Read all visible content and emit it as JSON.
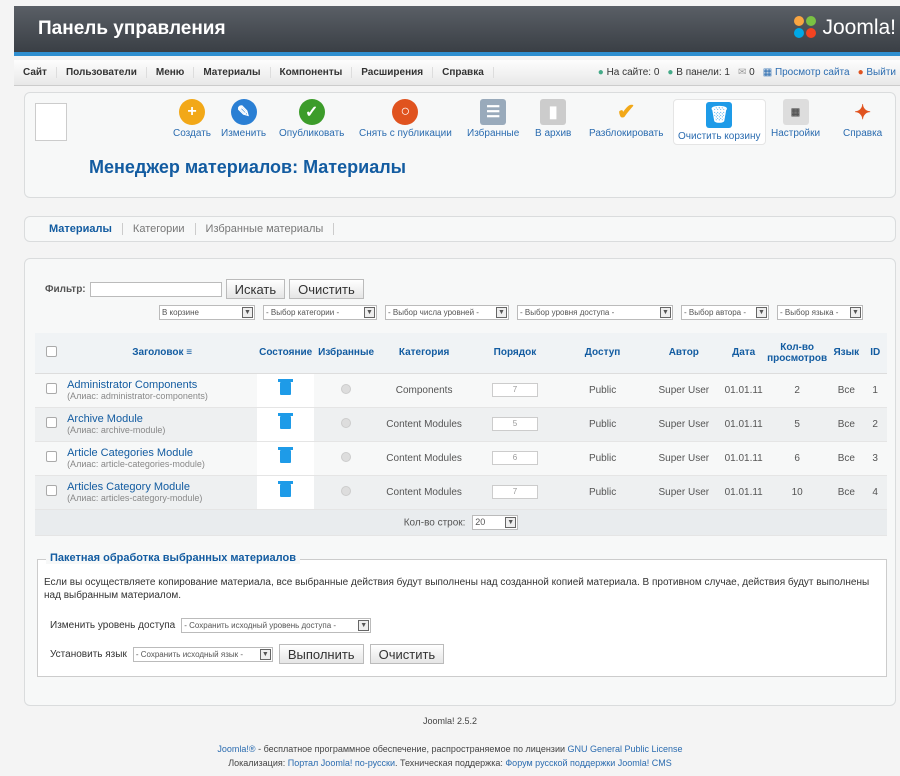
{
  "header": {
    "title": "Панель управления",
    "logo_text": "Joomla!"
  },
  "menu": {
    "items": [
      "Сайт",
      "Пользователи",
      "Меню",
      "Материалы",
      "Компоненты",
      "Расширения",
      "Справка"
    ],
    "status": {
      "on_site": "На сайте: 0",
      "in_panel": "В панели: 1",
      "messages": "0",
      "view_site": "Просмотр сайта",
      "logout": "Выйти"
    }
  },
  "toolbar": {
    "items": [
      {
        "label": "Создать",
        "icon": "plus-icon",
        "color": "#f2a818"
      },
      {
        "label": "Изменить",
        "icon": "edit-icon",
        "color": "#2a7fd4"
      },
      {
        "label": "Опубликовать",
        "icon": "check-icon",
        "color": "#3c9c2a"
      },
      {
        "label": "Снять с публикации",
        "icon": "unpublish-icon",
        "color": "#e0531f"
      },
      {
        "label": "Избранные",
        "icon": "featured-icon",
        "color": "#9ab"
      },
      {
        "label": "В архив",
        "icon": "archive-icon",
        "color": "#aaa"
      },
      {
        "label": "Разблокировать",
        "icon": "checkin-icon",
        "color": "#f2a818"
      },
      {
        "label": "Очистить корзину",
        "icon": "trash-icon",
        "color": "#1e9be8"
      },
      {
        "label": "Настройки",
        "icon": "options-icon",
        "color": "#999"
      },
      {
        "label": "Справка",
        "icon": "help-icon",
        "color": "#e0531f"
      }
    ],
    "page_title": "Менеджер материалов: Материалы"
  },
  "tabs": [
    "Материалы",
    "Категории",
    "Избранные материалы"
  ],
  "filter": {
    "label": "Фильтр:",
    "search_btn": "Искать",
    "clear_btn": "Очистить",
    "selects": [
      "В корзине",
      "- Выбор категории -",
      "- Выбор числа уровней -",
      "- Выбор уровня доступа -",
      "- Выбор автора -",
      "- Выбор языка -"
    ]
  },
  "table": {
    "headers": [
      "Заголовок",
      "Состояние",
      "Избранные",
      "Категория",
      "Порядок",
      "Доступ",
      "Автор",
      "Дата",
      "Кол-во просмотров",
      "Язык",
      "ID"
    ],
    "rows": [
      {
        "title": "Administrator Components",
        "alias": "(Алиас: administrator-components)",
        "category": "Components",
        "order": "7",
        "access": "Public",
        "author": "Super User",
        "date": "01.01.11",
        "hits": "2",
        "lang": "Все",
        "id": "1"
      },
      {
        "title": "Archive Module",
        "alias": "(Алиас: archive-module)",
        "category": "Content Modules",
        "order": "5",
        "access": "Public",
        "author": "Super User",
        "date": "01.01.11",
        "hits": "5",
        "lang": "Все",
        "id": "2"
      },
      {
        "title": "Article Categories Module",
        "alias": "(Алиас: article-categories-module)",
        "category": "Content Modules",
        "order": "6",
        "access": "Public",
        "author": "Super User",
        "date": "01.01.11",
        "hits": "6",
        "lang": "Все",
        "id": "3"
      },
      {
        "title": "Articles Category Module",
        "alias": "(Алиас: articles-category-module)",
        "category": "Content Modules",
        "order": "7",
        "access": "Public",
        "author": "Super User",
        "date": "01.01.11",
        "hits": "10",
        "lang": "Все",
        "id": "4"
      }
    ],
    "rows_label": "Кол-во строк:",
    "rows_value": "20"
  },
  "batch": {
    "legend": "Пакетная обработка выбранных материалов",
    "text": "Если вы осуществляете копирование материала, все выбранные действия будут выполнены над созданной копией материала. В противном случае, действия будут выполнены над выбранным материалом.",
    "access_label": "Изменить уровень доступа",
    "access_select": "- Сохранить исходный уровень доступа -",
    "lang_label": "Установить язык",
    "lang_select": "- Сохранить исходный язык -",
    "run_btn": "Выполнить",
    "clear_btn": "Очистить"
  },
  "footer": {
    "version": "Joomla! 2.5.2",
    "line1_a": "Joomla!®",
    "line1_b": " - бесплатное программное обеспечение, распространяемое по лицензии ",
    "line1_link": "GNU General Public License",
    "line2_a": "Локализация: ",
    "line2_link1": "Портал Joomla! по-русски",
    "line2_b": ". Техническая поддержка: ",
    "line2_link2": "Форум русской поддержки Joomla! CMS"
  }
}
